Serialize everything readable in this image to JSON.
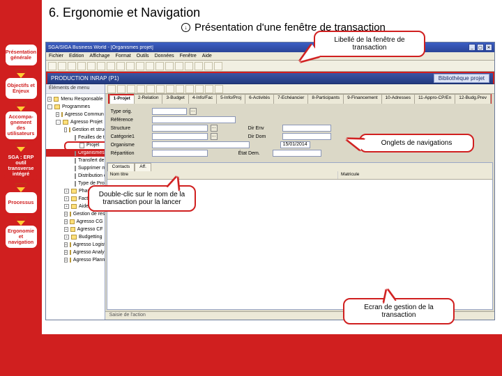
{
  "slide": {
    "title": "6. Ergonomie et Navigation",
    "subtitle": "Présentation d'une fenêtre de transaction",
    "subtitle_icon": "↓"
  },
  "nav": {
    "items": [
      "Présentation générale",
      "Objectifs et Enjeux",
      "Accompa-gnement des utilisateurs",
      "SGA : ERP outil transverse intégré",
      "Processus",
      "Ergonomie et navigation"
    ]
  },
  "callouts": {
    "c1": "Libellé de la fenêtre de transaction",
    "c2": "Onglets de navigations",
    "c3": "Double-clic sur le nom de la transaction pour la lancer",
    "c4": "Ecran de gestion de la transaction"
  },
  "app": {
    "title": "SGA/SIGA Business World - [Organismes projet]",
    "menu": [
      "Fichier",
      "Edition",
      "Affichage",
      "Format",
      "Outils",
      "Données",
      "Fenêtre",
      "Aide"
    ],
    "toolbar_buttons": 18,
    "bluebar": {
      "left": "PRODUCTION INRAP (P1)",
      "right": "Bibliothèque projet"
    },
    "tree": {
      "header": "Éléments de menu",
      "items": [
        {
          "indent": 0,
          "exp": "+",
          "icon": "fi",
          "label": "Menu Responsable"
        },
        {
          "indent": 0,
          "exp": "-",
          "icon": "fi",
          "label": "Programmes"
        },
        {
          "indent": 1,
          "exp": "+",
          "icon": "fi",
          "label": "Agresso Commun"
        },
        {
          "indent": 1,
          "exp": "-",
          "icon": "fi",
          "label": "Agresso Projet"
        },
        {
          "indent": 2,
          "exp": "-",
          "icon": "fi",
          "label": "Gestion et structure de Projets"
        },
        {
          "indent": 3,
          "exp": "",
          "icon": "doc",
          "label": "Feuilles de temps"
        },
        {
          "indent": 3,
          "exp": "",
          "icon": "doc",
          "label": "Projet",
          "highlight": true
        },
        {
          "indent": 3,
          "exp": "",
          "icon": "doc",
          "label": "Organismes projet",
          "selected": true
        },
        {
          "indent": 3,
          "exp": "",
          "icon": "doc",
          "label": "Transfert de matricules"
        },
        {
          "indent": 3,
          "exp": "",
          "icon": "doc",
          "label": "Supprimer matricules"
        },
        {
          "indent": 3,
          "exp": "",
          "icon": "doc",
          "label": "Distribution des coûts/règles"
        },
        {
          "indent": 3,
          "exp": "",
          "icon": "doc",
          "label": "Type de Projet"
        },
        {
          "indent": 2,
          "exp": "+",
          "icon": "fi",
          "label": "Phases"
        },
        {
          "indent": 2,
          "exp": "+",
          "icon": "fi",
          "label": "Facturation"
        },
        {
          "indent": 2,
          "exp": "+",
          "icon": "fi",
          "label": "Aide"
        },
        {
          "indent": 2,
          "exp": "+",
          "icon": "fi",
          "label": "Gestion de ressources"
        },
        {
          "indent": 2,
          "exp": "+",
          "icon": "fi",
          "label": "Agresso CG"
        },
        {
          "indent": 2,
          "exp": "+",
          "icon": "fi",
          "label": "Agresso CF"
        },
        {
          "indent": 2,
          "exp": "+",
          "icon": "fi",
          "label": "Budgetting"
        },
        {
          "indent": 2,
          "exp": "+",
          "icon": "fi",
          "label": "Agresso Logistique"
        },
        {
          "indent": 2,
          "exp": "+",
          "icon": "fi",
          "label": "Agresso Analytique"
        },
        {
          "indent": 2,
          "exp": "+",
          "icon": "fi",
          "label": "Agresso Planning"
        }
      ]
    },
    "main": {
      "tabs": [
        "1-Projet",
        "2-Relation",
        "3-Budget",
        "4-Info/Fac",
        "5-Info/Proj",
        "6-Activités",
        "7-Echéancier",
        "8-Participants",
        "9-Financement",
        "10-Adresses",
        "11-Appro-CP/En",
        "12-Budg.Prev"
      ],
      "form": [
        {
          "label": "Type orig.",
          "w": 50,
          "dot": true
        },
        {
          "label": "Référence",
          "w": 120
        },
        {
          "label": "Structure",
          "w": 80,
          "dot": true,
          "label2": "Dir Env",
          "w2": 70
        },
        {
          "label": "Catégorie1",
          "w": 80,
          "dot": true,
          "label2": "Dir Dom",
          "w2": 70
        },
        {
          "label": "Organisme",
          "w": 140,
          "date": "15/01/2014"
        },
        {
          "label": "Répartition",
          "w": 80,
          "label2": "État Dem.",
          "w2": 70
        }
      ],
      "grid_tabs": [
        "Contacts",
        "Aff."
      ],
      "grid_head": [
        "Nom titre",
        "Matricule"
      ],
      "status": "Saisie de l'action"
    }
  }
}
